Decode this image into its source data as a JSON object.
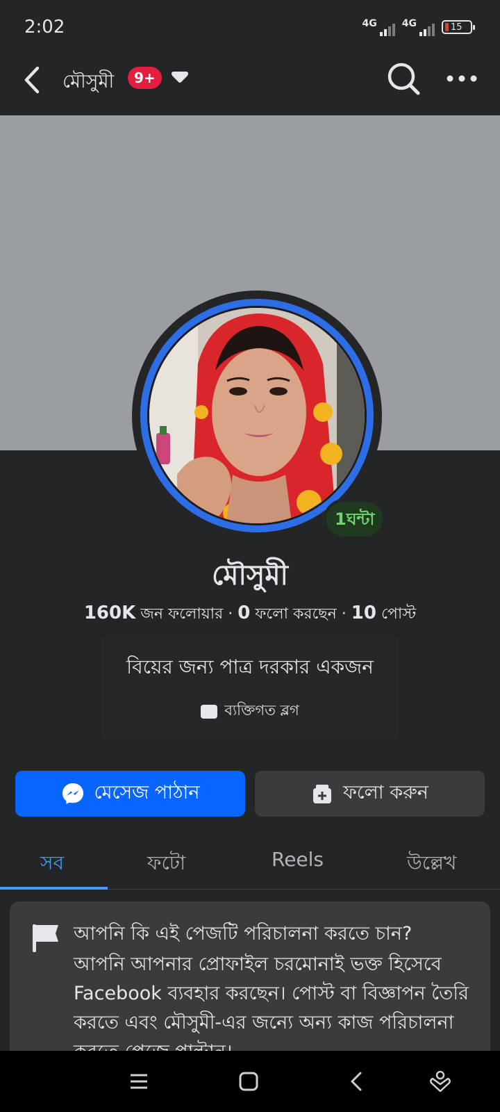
{
  "status_bar": {
    "time": "2:02",
    "network1": "4G",
    "network2": "4G",
    "battery": "15"
  },
  "top_nav": {
    "title": "মৌসুমী",
    "badge": "9+"
  },
  "profile": {
    "name": "মৌসুমী",
    "time_badge": "1ঘন্টা",
    "followers_count": "160K",
    "followers_label": "জন ফলোয়ার",
    "following_count": "0",
    "following_label": "ফলো করছেন",
    "posts_count": "10",
    "posts_label": "পোস্ট",
    "bio": "বিয়ের জন্য পাত্র দরকার একজন",
    "category": "ব্যক্তিগত ব্লগ"
  },
  "actions": {
    "message_label": "মেসেজ পাঠান",
    "follow_label": "ফলো করুন"
  },
  "tabs": [
    {
      "label": "সব"
    },
    {
      "label": "ফটো"
    },
    {
      "label": "Reels"
    },
    {
      "label": "উল্লেখ"
    }
  ],
  "notice": {
    "title": "আপনি কি এই পেজটি পরিচালনা করতে চান?",
    "body": "আপনি আপনার প্রোফাইল চরমোনাই ভক্ত হিসেবে Facebook ব্যবহার করছেন। পোস্ট বা বিজ্ঞাপন তৈরি করতে এবং মৌসুমী-এর জন্যে অন্য কাজ পরিচালনা করতে পেজে পাল্টান।"
  },
  "colors": {
    "accent": "#0866ff",
    "tab_active": "#4599ff",
    "badge_red": "#e41e3f",
    "background": "#242526"
  }
}
